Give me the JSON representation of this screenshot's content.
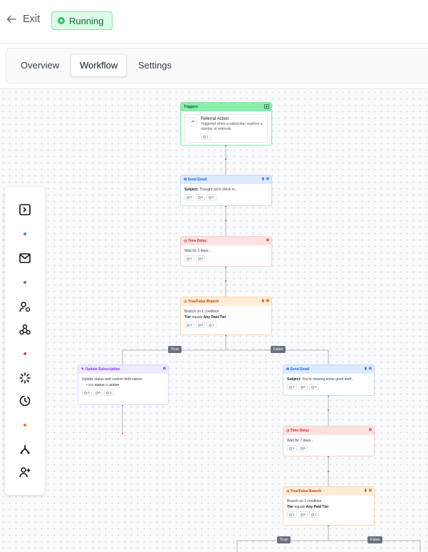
{
  "header": {
    "exit_label": "Exit",
    "status_label": "Running",
    "status_color": "#22c55e"
  },
  "tabs": [
    {
      "label": "Overview",
      "active": false
    },
    {
      "label": "Workflow",
      "active": true
    },
    {
      "label": "Settings",
      "active": false
    }
  ],
  "palette": {
    "icons": [
      "sidebar-toggle-icon",
      "mail-icon",
      "user-check-icon",
      "webhook-icon",
      "loader-icon",
      "clock-icon",
      "branch-icon",
      "user-plus-icon"
    ],
    "dot_colors": [
      "#3b82f6",
      "#6366f1",
      "#ef4444",
      "#f97316"
    ]
  },
  "nodes": {
    "trigger": {
      "header": "Triggers",
      "title": "Referral Action",
      "desc1": "Triggered when a subscriber reaches a",
      "desc2": "number of referrals.",
      "count": "1"
    },
    "email1": {
      "header": "Send Email",
      "subject_label": "Subject:",
      "subject": "Thought we'd check in...",
      "stats": [
        "0",
        "0",
        "0"
      ]
    },
    "delay1": {
      "header": "Time Delay",
      "text": "Wait for 3 days...",
      "stats": [
        "0",
        "0"
      ]
    },
    "branch1": {
      "header": "True/False Branch",
      "text": "Branch on 1 condition",
      "cond_field": "Tier",
      "cond_op": "equals",
      "cond_value": "Any Paid Tier",
      "stats": [
        "0",
        "0",
        "1"
      ]
    },
    "update": {
      "header": "Update Subscription",
      "text": "Update status and custom field values",
      "bullet_prefix": "Set",
      "bullet_field": "status",
      "bullet_to": "to",
      "bullet_value": "active",
      "stats": [
        "0",
        "0",
        "0"
      ]
    },
    "email2": {
      "header": "Send Email",
      "subject_label": "Subject:",
      "subject": "You're missing some good stuff...",
      "stats": [
        "0",
        "0",
        "0"
      ]
    },
    "delay2": {
      "header": "Time Delay",
      "text": "Wait for 7 days...",
      "stats": [
        "0",
        "0"
      ]
    },
    "branch2": {
      "header": "True/False Branch",
      "text": "Branch on 1 condition",
      "cond_field": "Tier",
      "cond_op": "equals",
      "cond_value": "Any Paid Tier",
      "stats": [
        "0",
        "0",
        "1"
      ]
    }
  },
  "badges": {
    "true1": "True",
    "false1": "False",
    "true2": "True",
    "false2": "False"
  }
}
